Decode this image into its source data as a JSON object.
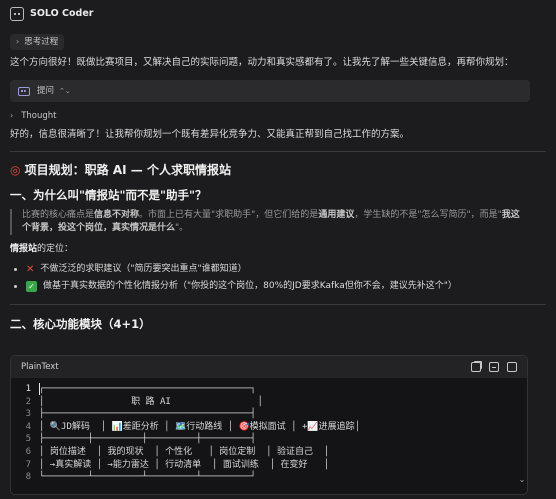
{
  "app": {
    "title": "SOLO Coder"
  },
  "thinking_toggle": {
    "label": "思考过程"
  },
  "intro_text": "这个方向很好！既做比赛项目，又解决自己的实际问题，动力和真实感都有了。让我先了解一些关键信息，再帮你规划：",
  "ask_box": {
    "label": "提问"
  },
  "thought_toggle": {
    "label": "Thought"
  },
  "reply_text": "好的，信息很清晰了！让我帮你规划一个既有差异化竞争力、又能真正帮到自己找工作的方案。",
  "plan_title": "项目规划：职路 AI — 个人求职情报站",
  "plan_icon": "target-icon",
  "section1": {
    "title": "一、为什么叫\"情报站\"而不是\"助手\"？",
    "quote_line1_prefix": "比赛的核心痛点是",
    "quote_bold1": "信息不对称",
    "quote_line1_mid": "。市面上已有大量\"求职助手\"，但它们给的是",
    "quote_bold2": "通用建议",
    "quote_line1_suffix": "，学生缺的不是\"怎么写简历\"，而是\"",
    "quote_bold3": "我这",
    "quote_line2_bold": "个背景，投这个岗位，真实情况是什么",
    "quote_line2_suffix": "\"。",
    "positioning_bold": "情报站",
    "positioning_rest": "的定位：",
    "bullets": [
      {
        "icon": "cross-icon",
        "text": "不做泛泛的求职建议（\"简历要突出重点\"谁都知道）"
      },
      {
        "icon": "check-icon",
        "text": "做基于真实数据的个性化情报分析（\"你投的这个岗位，80%的JD要求Kafka但你不会，建议先补这个\"）"
      }
    ]
  },
  "section2": {
    "title": "二、核心功能模块（4+1）"
  },
  "code_block": {
    "language": "PlainText",
    "line_numbers": [
      "1",
      "2",
      "3",
      "4",
      "5",
      "6",
      "7",
      "8"
    ],
    "lines": [
      "┌──────────────────────────────────────┐",
      "│                职 路 AI                │",
      "├──────────────────────────────────────┤",
      "│ 🔍JD解码  │ 📊差距分析 │ 🗺️行动路线 │ 🎯模拟面试 │ +📈进展追踪│",
      "├────────┼─────────┼─────────┼─────────┤",
      "│ 岗位描述  │ 我的现状  │ 个性化   │ 岗位定制  │ 验证自己  │",
      "│ →真实解读 │ →能力雷达 │ 行动清单  │ 面试训练  │ 在变好   │",
      "└────────┴─────────┴─────────┴─────────┘"
    ]
  }
}
